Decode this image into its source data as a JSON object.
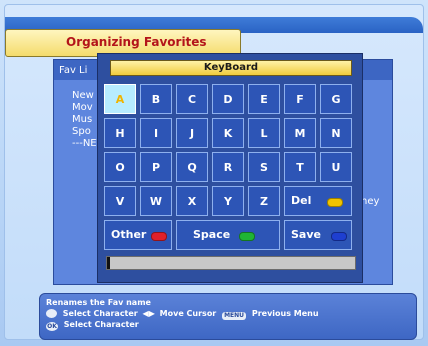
{
  "window": {
    "title": "Organizing Favorites"
  },
  "fav_list": {
    "label": "Fav Li",
    "items": [
      "New",
      "Mov",
      "Mus",
      "Spo",
      "---NEV"
    ],
    "right_fragment": "ney"
  },
  "keyboard": {
    "title": "KeyBoard",
    "rows": [
      [
        "A",
        "B",
        "C",
        "D",
        "E",
        "F",
        "G"
      ],
      [
        "H",
        "I",
        "J",
        "K",
        "L",
        "M",
        "N"
      ],
      [
        "O",
        "P",
        "Q",
        "R",
        "S",
        "T",
        "U"
      ],
      [
        "V",
        "W",
        "X",
        "Y",
        "Z"
      ]
    ],
    "selected_key": "A",
    "del_label": "Del",
    "other_label": "Other",
    "space_label": "Space",
    "save_label": "Save",
    "input_value": "",
    "colors": {
      "del": "#f0c400",
      "other": "#e0202a",
      "space": "#1fb534",
      "save": "#1e3fd0"
    }
  },
  "help": {
    "line1": "Renames the Fav name",
    "select_char_label": "Select Character",
    "move_cursor_label": "Move Cursor",
    "menu_icon": "MENU",
    "previous_menu_label": "Previous Menu",
    "ok_icon": "OK",
    "ok_select_label": "Select Character"
  }
}
